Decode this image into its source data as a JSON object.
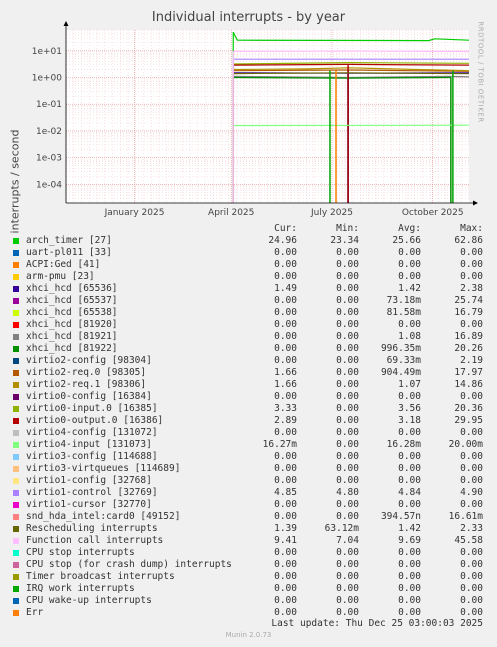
{
  "title": "Individual interrupts - by year",
  "side_label": "RRDTOOL / TOBI OETIKER",
  "legend_headers": {
    "cur": "Cur:",
    "min": "Min:",
    "avg": "Avg:",
    "max": "Max:"
  },
  "last_update": "Last update: Thu Dec 25 03:00:03 2025",
  "footer": "Munin 2.0.73",
  "chart_data": {
    "type": "line",
    "title": "Individual interrupts - by year",
    "ylabel": "interrupts / second",
    "yscale": "log",
    "ylim": [
      2e-05,
      60
    ],
    "yticks": [
      {
        "v": 10,
        "label": "1e+01"
      },
      {
        "v": 1,
        "label": "1e+00"
      },
      {
        "v": 0.1,
        "label": "1e-01"
      },
      {
        "v": 0.01,
        "label": "1e-02"
      },
      {
        "v": 0.001,
        "label": "1e-03"
      },
      {
        "v": 0.0001,
        "label": "1e-04"
      }
    ],
    "xticks": [
      {
        "t": 0.17,
        "label": "January 2025"
      },
      {
        "t": 0.41,
        "label": "April 2025"
      },
      {
        "t": 0.66,
        "label": "July 2025"
      },
      {
        "t": 0.91,
        "label": "October 2025"
      }
    ],
    "x_range": [
      "Dec 2024",
      "Dec 2025"
    ],
    "grid": true,
    "series": [
      {
        "name": "arch_timer [27]",
        "color": "#00cc00",
        "cur": "24.96",
        "min": "23.34",
        "avg": "25.66",
        "max": "62.86",
        "line": [
          [
            0.415,
            50
          ],
          [
            0.425,
            25
          ],
          [
            0.9,
            24
          ],
          [
            0.915,
            28
          ],
          [
            1,
            25
          ]
        ],
        "start": 0.415,
        "drop": []
      },
      {
        "name": "uart-pl011 [33]",
        "color": "#0066b3",
        "cur": "0.00",
        "min": "0.00",
        "avg": "0.00",
        "max": "0.00",
        "line": [],
        "start": 0,
        "drop": []
      },
      {
        "name": "ACPI:Ged [41]",
        "color": "#ff8000",
        "cur": "0.00",
        "min": "0.00",
        "avg": "0.00",
        "max": "0.00",
        "line": [],
        "start": 0,
        "drop": []
      },
      {
        "name": "arm-pmu [23]",
        "color": "#ffcc00",
        "cur": "0.00",
        "min": "0.00",
        "avg": "0.00",
        "max": "0.00",
        "line": [],
        "start": 0,
        "drop": []
      },
      {
        "name": "xhci_hcd [65536]",
        "color": "#330099",
        "cur": "1.49",
        "min": "0.00",
        "avg": "1.42",
        "max": "2.38",
        "line": [
          [
            0.415,
            1.5
          ],
          [
            0.7,
            1.45
          ],
          [
            1,
            1.49
          ]
        ],
        "start": 0.415,
        "drop": [
          0.7
        ]
      },
      {
        "name": "xhci_hcd [65537]",
        "color": "#990099",
        "cur": "0.00",
        "min": "0.00",
        "avg": "73.18m",
        "max": "25.74",
        "line": [],
        "start": 0,
        "drop": []
      },
      {
        "name": "xhci_hcd [65538]",
        "color": "#ccff00",
        "cur": "0.00",
        "min": "0.00",
        "avg": "81.58m",
        "max": "16.79",
        "line": [],
        "start": 0,
        "drop": []
      },
      {
        "name": "xhci_hcd [81920]",
        "color": "#ff0000",
        "cur": "0.00",
        "min": "0.00",
        "avg": "0.00",
        "max": "0.00",
        "line": [],
        "start": 0,
        "drop": []
      },
      {
        "name": "xhci_hcd [81921]",
        "color": "#808080",
        "cur": "0.00",
        "min": "0.00",
        "avg": "1.08",
        "max": "16.89",
        "line": [
          [
            0.415,
            1.1
          ],
          [
            0.7,
            1.0
          ],
          [
            0.95,
            1.1
          ],
          [
            1,
            1.05
          ]
        ],
        "start": 0.415,
        "drop": []
      },
      {
        "name": "xhci_hcd [81922]",
        "color": "#008f00",
        "cur": "0.00",
        "min": "0.00",
        "avg": "996.35m",
        "max": "20.26",
        "line": [
          [
            0.415,
            1.0
          ],
          [
            0.7,
            0.95
          ],
          [
            0.955,
            1.0
          ]
        ],
        "start": 0.415,
        "drop": [
          0.955
        ]
      },
      {
        "name": "virtio2-config [98304]",
        "color": "#00487d",
        "cur": "0.00",
        "min": "0.00",
        "avg": "69.33m",
        "max": "2.19",
        "line": [],
        "start": 0,
        "drop": [
          0.7
        ]
      },
      {
        "name": "virtio2-req.0 [98305]",
        "color": "#b35a00",
        "cur": "1.66",
        "min": "0.00",
        "avg": "904.49m",
        "max": "17.97",
        "line": [
          [
            0.415,
            1.8
          ],
          [
            0.7,
            1.9
          ],
          [
            1,
            1.7
          ]
        ],
        "start": 0.415,
        "drop": []
      },
      {
        "name": "virtio2-req.1 [98306]",
        "color": "#b38f00",
        "cur": "1.66",
        "min": "0.00",
        "avg": "1.07",
        "max": "14.86",
        "line": [
          [
            0.415,
            2.0
          ],
          [
            0.6,
            2.1
          ],
          [
            0.7,
            2.3
          ],
          [
            1,
            1.8
          ]
        ],
        "start": 0.415,
        "drop": []
      },
      {
        "name": "virtio0-config [16384]",
        "color": "#6b006b",
        "cur": "0.00",
        "min": "0.00",
        "avg": "0.00",
        "max": "0.00",
        "line": [],
        "start": 0,
        "drop": []
      },
      {
        "name": "virtio0-input.0 [16385]",
        "color": "#8fb300",
        "cur": "3.33",
        "min": "0.00",
        "avg": "3.56",
        "max": "20.36",
        "line": [
          [
            0.415,
            3.2
          ],
          [
            0.7,
            3.6
          ],
          [
            1,
            3.4
          ]
        ],
        "start": 0.415,
        "drop": []
      },
      {
        "name": "virtio0-output.0 [16386]",
        "color": "#b30000",
        "cur": "2.89",
        "min": "0.00",
        "avg": "3.18",
        "max": "29.95",
        "line": [
          [
            0.415,
            2.9
          ],
          [
            0.7,
            3.1
          ],
          [
            1,
            2.9
          ]
        ],
        "start": 0.415,
        "drop": [
          0.7
        ]
      },
      {
        "name": "virtio4-config [131072]",
        "color": "#bebebe",
        "cur": "0.00",
        "min": "0.00",
        "avg": "0.00",
        "max": "0.00",
        "line": [],
        "start": 0,
        "drop": []
      },
      {
        "name": "virtio4-input [131073]",
        "color": "#80ff80",
        "cur": "16.27m",
        "min": "0.00",
        "avg": "16.28m",
        "max": "20.00m",
        "line": [
          [
            0.415,
            0.016
          ],
          [
            1,
            0.0163
          ]
        ],
        "start": 0.415,
        "drop": []
      },
      {
        "name": "virtio3-config [114688]",
        "color": "#80c9ff",
        "cur": "0.00",
        "min": "0.00",
        "avg": "0.00",
        "max": "0.00",
        "line": [],
        "start": 0,
        "drop": []
      },
      {
        "name": "virtio3-virtqueues [114689]",
        "color": "#ffc080",
        "cur": "0.00",
        "min": "0.00",
        "avg": "0.00",
        "max": "0.00",
        "line": [],
        "start": 0,
        "drop": []
      },
      {
        "name": "virtio1-config [32768]",
        "color": "#ffe680",
        "cur": "0.00",
        "min": "0.00",
        "avg": "0.00",
        "max": "0.00",
        "line": [],
        "start": 0,
        "drop": []
      },
      {
        "name": "virtio1-control [32769]",
        "color": "#aa80ff",
        "cur": "4.85",
        "min": "4.80",
        "avg": "4.84",
        "max": "4.90",
        "line": [
          [
            0.415,
            4.85
          ],
          [
            1,
            4.85
          ]
        ],
        "start": 0.415,
        "drop": []
      },
      {
        "name": "virtio1-cursor [32770]",
        "color": "#ee00cc",
        "cur": "0.00",
        "min": "0.00",
        "avg": "0.00",
        "max": "0.00",
        "line": [],
        "start": 0,
        "drop": []
      },
      {
        "name": "snd_hda_intel:card0 [49152]",
        "color": "#ff8080",
        "cur": "0.00",
        "min": "0.00",
        "avg": "394.57n",
        "max": "16.61m",
        "line": [],
        "start": 0,
        "drop": []
      },
      {
        "name": "Rescheduling interrupts",
        "color": "#666600",
        "cur": "1.39",
        "min": "63.12m",
        "avg": "1.42",
        "max": "2.33",
        "line": [
          [
            0.415,
            1.4
          ],
          [
            0.7,
            1.5
          ],
          [
            1,
            1.39
          ]
        ],
        "start": 0.415,
        "drop": []
      },
      {
        "name": "Function call interrupts",
        "color": "#ffbfff",
        "cur": "9.41",
        "min": "7.04",
        "avg": "9.69",
        "max": "45.58",
        "line": [
          [
            0.415,
            9.5
          ],
          [
            0.7,
            9.8
          ],
          [
            1,
            9.4
          ]
        ],
        "start": 0.415,
        "drop": []
      },
      {
        "name": "CPU stop interrupts",
        "color": "#00ffcc",
        "cur": "0.00",
        "min": "0.00",
        "avg": "0.00",
        "max": "0.00",
        "line": [],
        "start": 0,
        "drop": []
      },
      {
        "name": "CPU stop (for crash dump) interrupts",
        "color": "#cc6699",
        "cur": "0.00",
        "min": "0.00",
        "avg": "0.00",
        "max": "0.00",
        "line": [],
        "start": 0,
        "drop": []
      },
      {
        "name": "Timer broadcast interrupts",
        "color": "#999900",
        "cur": "0.00",
        "min": "0.00",
        "avg": "0.00",
        "max": "0.00",
        "line": [],
        "start": 0,
        "drop": []
      },
      {
        "name": "IRQ work interrupts",
        "color": "#00a800",
        "cur": "0.00",
        "min": "0.00",
        "avg": "0.00",
        "max": "0.00",
        "line": [],
        "start": 0,
        "drop": [
          0.655,
          0.96
        ]
      },
      {
        "name": "CPU wake-up interrupts",
        "color": "#0066b3",
        "cur": "0.00",
        "min": "0.00",
        "avg": "0.00",
        "max": "0.00",
        "line": [],
        "start": 0,
        "drop": []
      },
      {
        "name": "Err",
        "color": "#ff8000",
        "cur": "0.00",
        "min": "0.00",
        "avg": "0.00",
        "max": "0.00",
        "line": [],
        "start": 0,
        "drop": [
          0.67
        ]
      }
    ]
  }
}
